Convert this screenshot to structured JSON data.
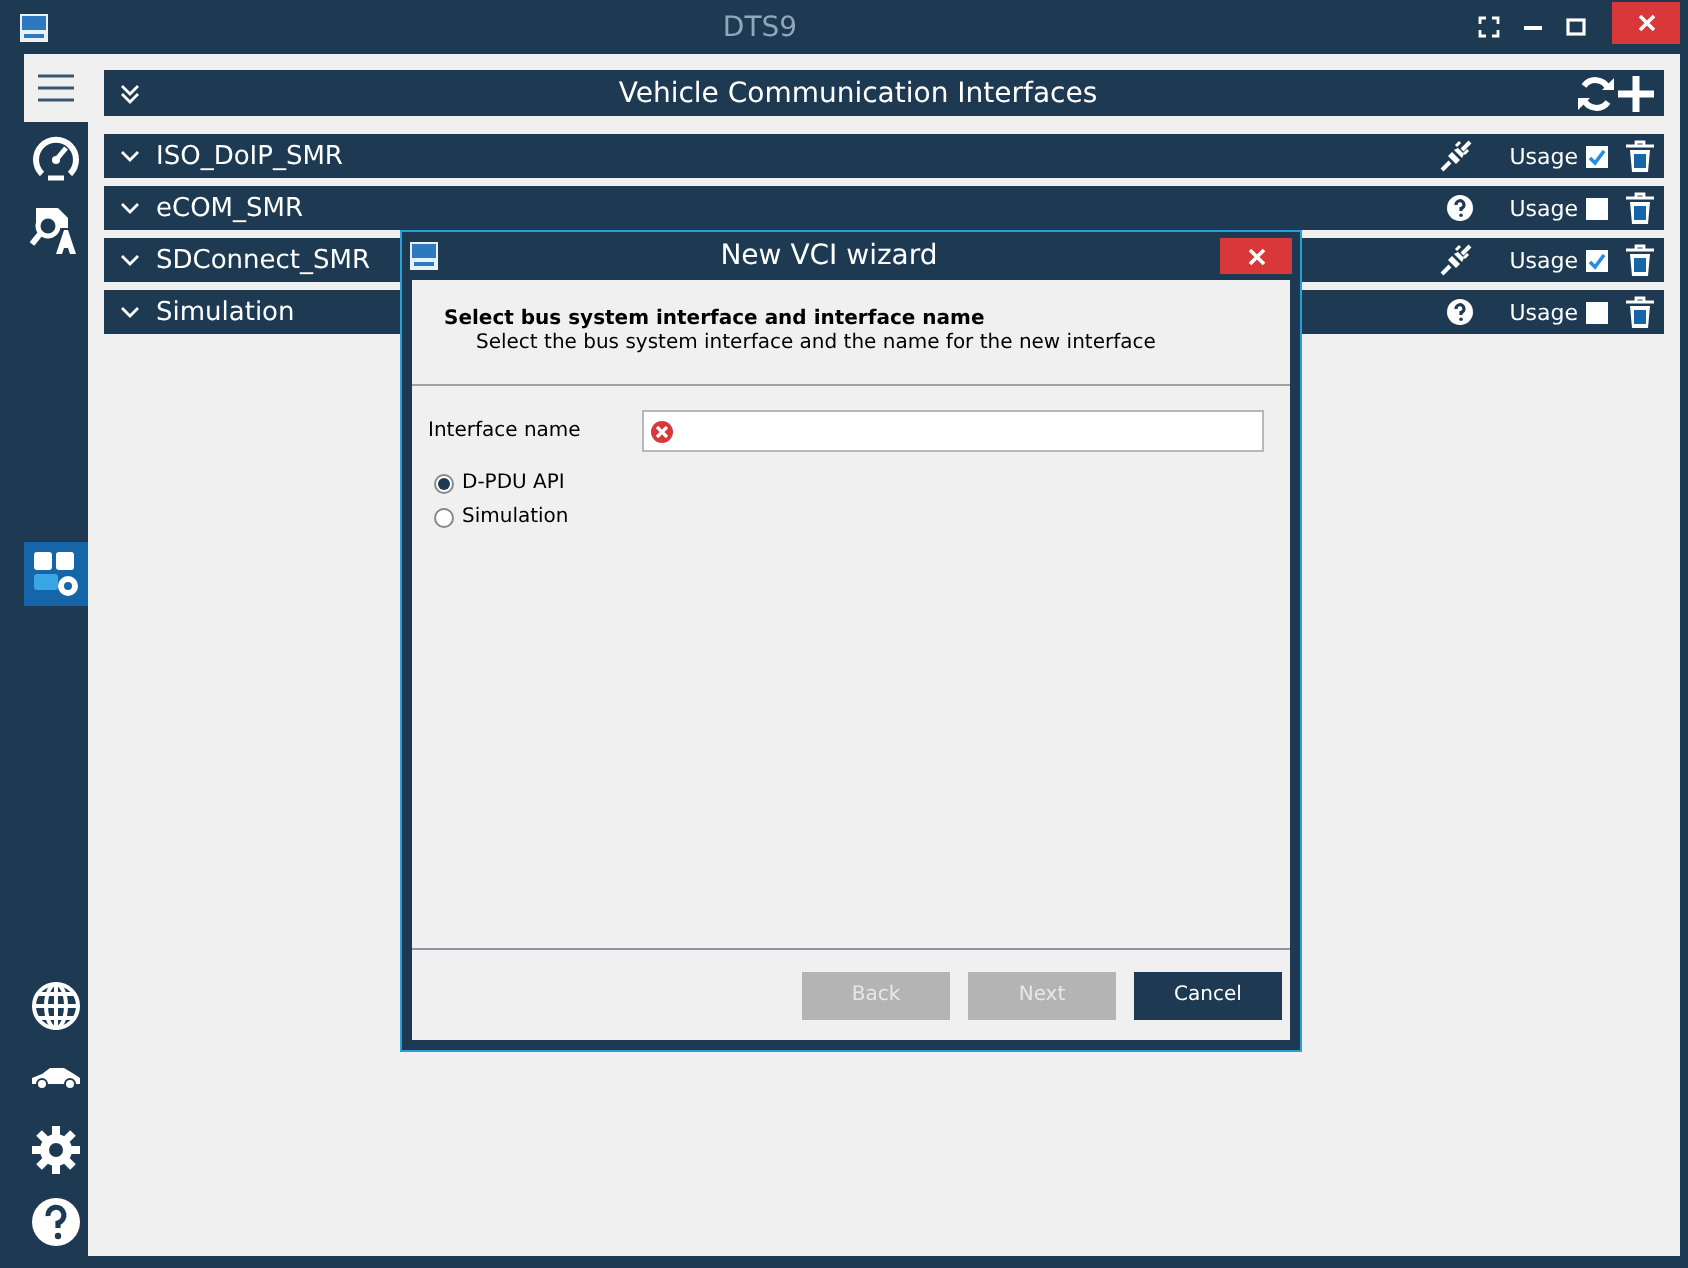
{
  "window": {
    "title": "DTS9"
  },
  "sidebar": {
    "items": [
      {
        "kind": "menu",
        "selected": false
      },
      {
        "kind": "gauge",
        "selected": false
      },
      {
        "kind": "search",
        "selected": false
      },
      {
        "kind": "apps",
        "selected": true
      },
      {
        "kind": "globe",
        "selected": false
      },
      {
        "kind": "car",
        "selected": false
      },
      {
        "kind": "gear",
        "selected": false
      },
      {
        "kind": "help",
        "selected": false
      }
    ]
  },
  "header": {
    "title": "Vehicle Communication Interfaces"
  },
  "interfaces": [
    {
      "name": "ISO_DoIP_SMR",
      "kind": "plug",
      "usage_label": "Usage",
      "checked": true
    },
    {
      "name": "eCOM_SMR",
      "kind": "unknown",
      "usage_label": "Usage",
      "checked": false
    },
    {
      "name": "SDConnect_SMR",
      "kind": "plug",
      "usage_label": "Usage",
      "checked": true
    },
    {
      "name": "Simulation",
      "kind": "unknown",
      "usage_label": "Usage",
      "checked": false
    }
  ],
  "dialog": {
    "title": "New VCI wizard",
    "heading": "Select bus system interface and interface name",
    "subheading": "Select the bus system interface and the name for the new interface",
    "field_label": "Interface name",
    "field_invalid": true,
    "options": [
      {
        "label": "D-PDU API",
        "selected": true
      },
      {
        "label": "Simulation",
        "selected": false
      }
    ],
    "buttons": [
      {
        "label": "Back",
        "disabled": true
      },
      {
        "label": "Next",
        "disabled": true
      },
      {
        "label": "Cancel",
        "disabled": false
      }
    ]
  }
}
